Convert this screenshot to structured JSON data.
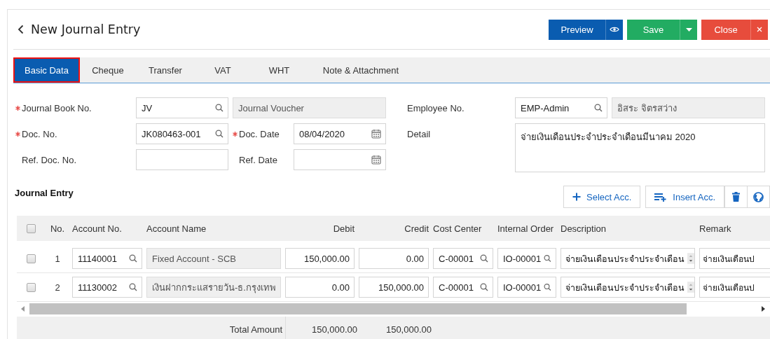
{
  "page_title": "New Journal Entry",
  "actions": [
    {
      "kind": "preview",
      "label": "Preview"
    },
    {
      "kind": "save",
      "label": "Save"
    },
    {
      "kind": "close",
      "label": "Close"
    }
  ],
  "tabs": [
    {
      "label": "Basic Data",
      "selected": true
    },
    {
      "label": "Cheque",
      "selected": false
    },
    {
      "label": "Transfer",
      "selected": false
    },
    {
      "label": "VAT",
      "selected": false
    },
    {
      "label": "WHT",
      "selected": false
    },
    {
      "label": "Note & Attachment",
      "selected": false
    }
  ],
  "form": {
    "journal_book_no": {
      "label": "Journal Book No.",
      "required": true,
      "value": "JV",
      "name": "Journal Voucher"
    },
    "doc_no": {
      "label": "Doc. No.",
      "required": true,
      "value": "JK080463-001"
    },
    "doc_date": {
      "label": "Doc. Date",
      "required": true,
      "value": "08/04/2020"
    },
    "ref_doc_no": {
      "label": "Ref. Doc. No.",
      "required": false
    },
    "ref_date": {
      "label": "Ref. Date",
      "required": false
    },
    "employee_no": {
      "label": "Employee No.",
      "required": false,
      "value": "EMP-Admin",
      "name": "อิสระ จิตรสว่าง"
    },
    "detail": {
      "label": "Detail",
      "required": false,
      "value": "จ่ายเงินเดือนประจำประจำเดือนมีนาคม 2020"
    }
  },
  "journal_entry": {
    "title": "Journal Entry",
    "toolbar": [
      {
        "kind": "select",
        "label": "Select Acc."
      },
      {
        "kind": "insert",
        "label": "Insert Acc."
      },
      {
        "kind": "delete"
      },
      {
        "kind": "globe"
      }
    ],
    "table": {
      "all_selected": false,
      "columns": [
        "No.",
        "Account No.",
        "Account Name",
        "Debit",
        "Credit",
        "Cost Center",
        "Internal Order",
        "Description",
        "Remark"
      ],
      "rows": [
        {
          "selected": false,
          "no": "1",
          "account_no": "11140001",
          "account_name": "Fixed Account - SCB",
          "debit": "150,000.00",
          "credit": "0.00",
          "cost_center": "C-00001",
          "internal_order": "IO-00001",
          "description": "จ่ายเงินเดือนประจำประจำเดือน",
          "remark": "จ่ายเงินเดือนป"
        },
        {
          "selected": false,
          "no": "2",
          "account_no": "11130002",
          "account_name": "เงินฝากกระแสรายวัน-ธ.กรุงเทพ",
          "debit": "0.00",
          "credit": "150,000.00",
          "cost_center": "C-00001",
          "internal_order": "IO-00001",
          "description": "จ่ายเงินเดือนประจำประจำเดือน",
          "remark": "จ่ายเงินเดือนป"
        }
      ],
      "total": {
        "label": "Total Amount",
        "debit": "150,000.00",
        "credit": "150,000.00"
      }
    }
  }
}
